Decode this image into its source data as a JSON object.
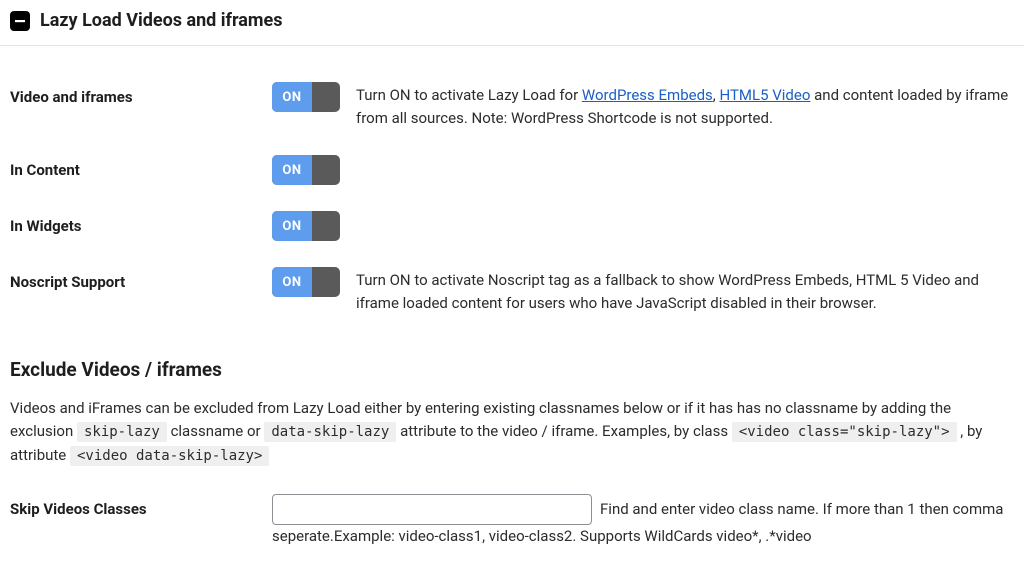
{
  "panel": {
    "title": "Lazy Load Videos and iframes"
  },
  "toggle_text": "ON",
  "rows": {
    "video_iframes": {
      "label": "Video and iframes",
      "desc_before": "Turn ON to activate Lazy Load for ",
      "link1": "WordPress Embeds",
      "sep": ", ",
      "link2": "HTML5 Video",
      "desc_after": " and content loaded by iframe from all sources. Note: WordPress Shortcode is not supported."
    },
    "in_content": {
      "label": "In Content"
    },
    "in_widgets": {
      "label": "In Widgets"
    },
    "noscript": {
      "label": "Noscript Support",
      "desc": "Turn ON to activate Noscript tag as a fallback to show WordPress Embeds, HTML 5 Video and iframe loaded content for users who have JavaScript disabled in their browser."
    }
  },
  "exclude": {
    "title": "Exclude Videos / iframes",
    "p1a": "Videos and iFrames can be excluded from Lazy Load either by entering existing classnames below or if it has has no classname by adding the exclusion ",
    "code1": "skip-lazy",
    "p1b": " classname or ",
    "code2": "data-skip-lazy",
    "p1c": " attribute to the video / iframe. Examples, by class ",
    "code3": "<video class=\"skip-lazy\">",
    "p1d": " , by attribute ",
    "code4": "<video data-skip-lazy>"
  },
  "skip_classes": {
    "label": "Skip Videos Classes",
    "value": "",
    "desc_line1": "Find and enter video class name. If more than 1 then comma",
    "desc_line2": "seperate.Example: video-class1, video-class2. Supports WildCards video*, .*video"
  }
}
